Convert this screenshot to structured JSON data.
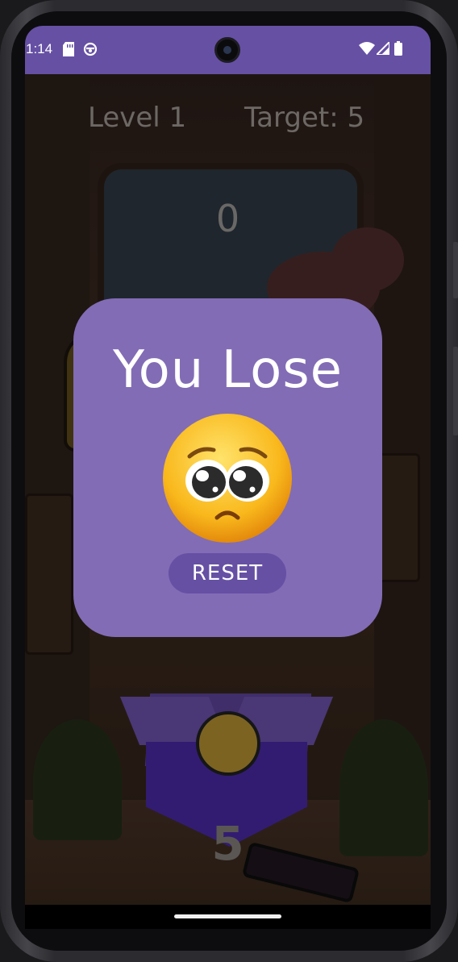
{
  "status_bar": {
    "time": "1:14",
    "background": "#6650a4",
    "icons": [
      "sd-card-icon",
      "circle-app-icon",
      "wifi-icon",
      "cellular-signal-icon",
      "battery-icon"
    ]
  },
  "game": {
    "level_label": "Level 1",
    "target_label": "Target: 5",
    "score": "0",
    "box_count": "5"
  },
  "dialog": {
    "title": "You Lose",
    "emoji": "pleading-face",
    "reset_label": "RESET",
    "background": "#826cb5",
    "button_color": "#6650a4"
  }
}
